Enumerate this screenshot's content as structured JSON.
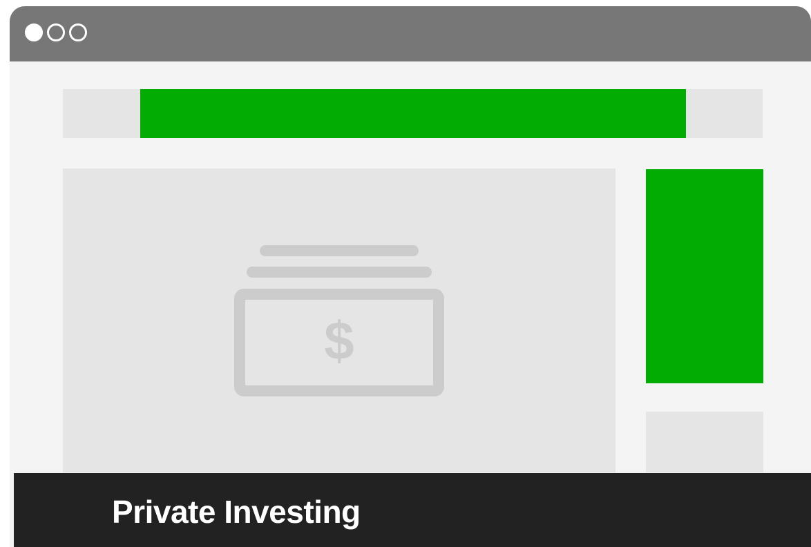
{
  "window": {
    "controls": [
      "window-dot-filled",
      "window-dot-outline",
      "window-dot-outline"
    ]
  },
  "colors": {
    "titlebar": "#777777",
    "accent": "#02ac02",
    "placeholder": "#e5e5e5",
    "footer": "#222222"
  },
  "main": {
    "icon": "money-bill-icon"
  },
  "footer": {
    "title": "Private Investing"
  }
}
